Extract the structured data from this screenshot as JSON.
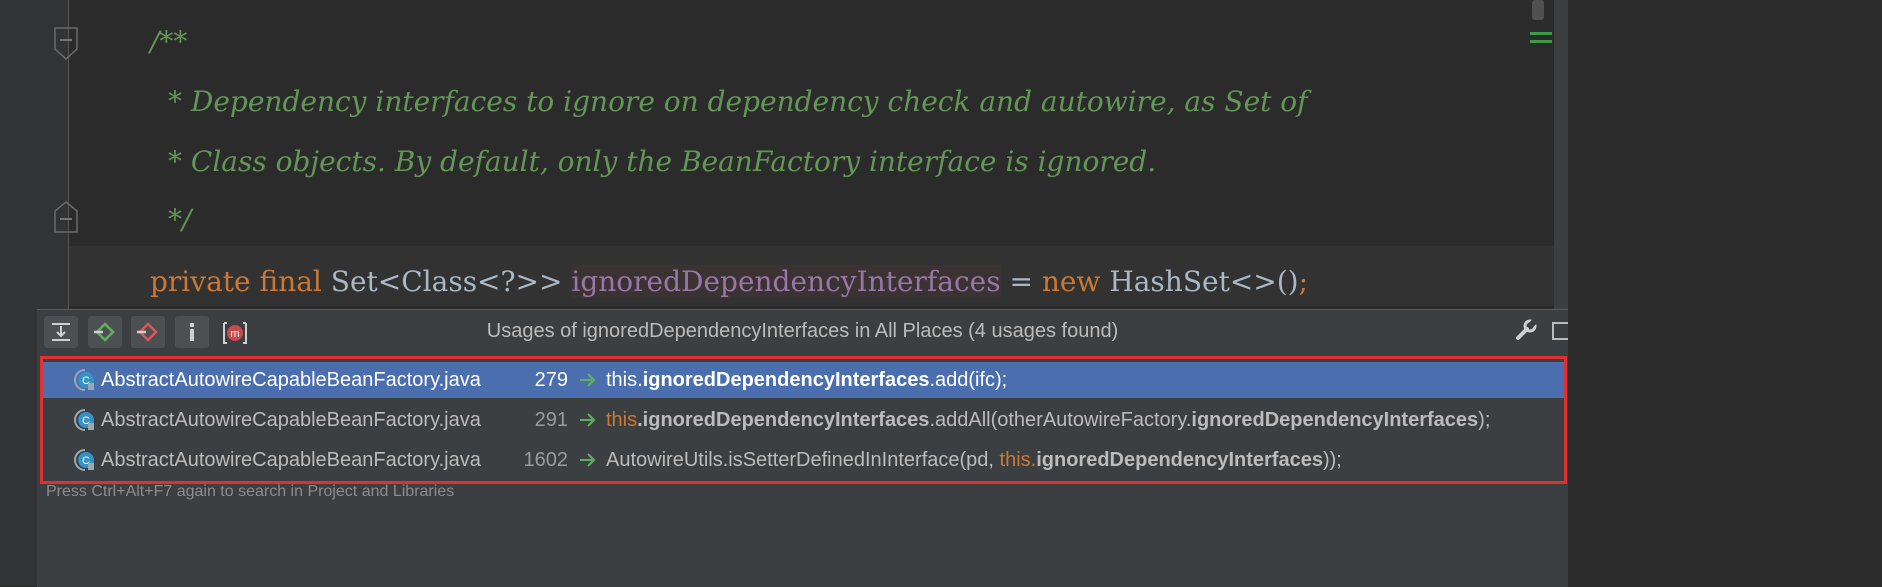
{
  "code": {
    "doc_open": "/**",
    "doc_line1": "* Dependency interfaces to ignore on dependency check and autowire, as Set of",
    "doc_line2": "* Class objects. By default, only the BeanFactory interface is ignored.",
    "doc_close": "*/",
    "kw_private": "private",
    "kw_final": "final",
    "type": "Set<Class<?>>",
    "field": "ignoredDependencyInterfaces",
    "assign": " = ",
    "kw_new": "new",
    "ctor": "HashSet<>()",
    "semi": ";"
  },
  "popup": {
    "title": "Usages of ignoredDependencyInterfaces in All Places (4 usages found)",
    "hint": "Press Ctrl+Alt+F7 again to search in Project and Libraries",
    "toolbar_m_label": "m"
  },
  "results": [
    {
      "file": "AbstractAutowireCapableBeanFactory.java",
      "line": "279",
      "code_prefix": "this.",
      "code_field": "ignoredDependencyInterfaces",
      "code_rest": ".add(ifc);",
      "code_mid": "",
      "code_this2": "",
      "code_field2": "",
      "code_tail": "",
      "selected": true
    },
    {
      "file": "AbstractAutowireCapableBeanFactory.java",
      "line": "291",
      "code_prefix": "this",
      "code_field": ".ignoredDependencyInterfaces",
      "code_rest": ".addAll(otherAutowireFactory.",
      "code_mid": "",
      "code_this2": "",
      "code_field2": "ignoredDependencyInterfaces",
      "code_tail": ");",
      "selected": false
    },
    {
      "file": "AbstractAutowireCapableBeanFactory.java",
      "line": "1602",
      "code_prefix": "",
      "code_field": "",
      "code_rest": "AutowireUtils.isSetterDefinedInInterface(pd, ",
      "code_mid": "",
      "code_this2": "this.",
      "code_field2": "ignoredDependencyInterfaces",
      "code_tail": "));",
      "selected": false
    }
  ],
  "colors": {
    "doc_comment": "#629755",
    "keyword": "#cc7832",
    "field": "#9876aa",
    "selection": "#4b6eaf",
    "highlight_border": "#e03030"
  }
}
